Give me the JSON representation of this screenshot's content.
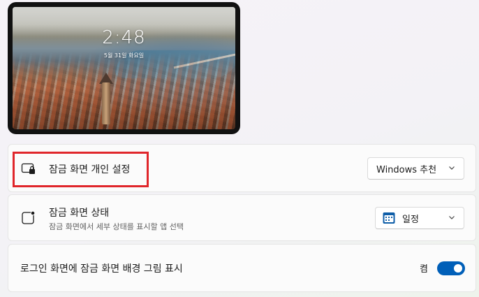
{
  "preview": {
    "time": "2:48",
    "date": "5월 31일 화요일"
  },
  "personalize": {
    "title": "잠금 화면 개인 설정",
    "dropdown_value": "Windows 추천",
    "icon": "lock-screen-icon"
  },
  "status": {
    "title": "잠금 화면 상태",
    "subtitle": "잠금 화면에서 세부 상태를 표시할 앱 선택",
    "dropdown_value": "일정",
    "icon": "status-badge-icon",
    "app_icon": "calendar-icon"
  },
  "signin_background": {
    "title": "로그인 화면에 잠금 화면 배경 그림 표시",
    "toggle_label": "켬",
    "toggle_on": true
  },
  "colors": {
    "accent": "#005fb8",
    "highlight_border": "#e0262b"
  }
}
